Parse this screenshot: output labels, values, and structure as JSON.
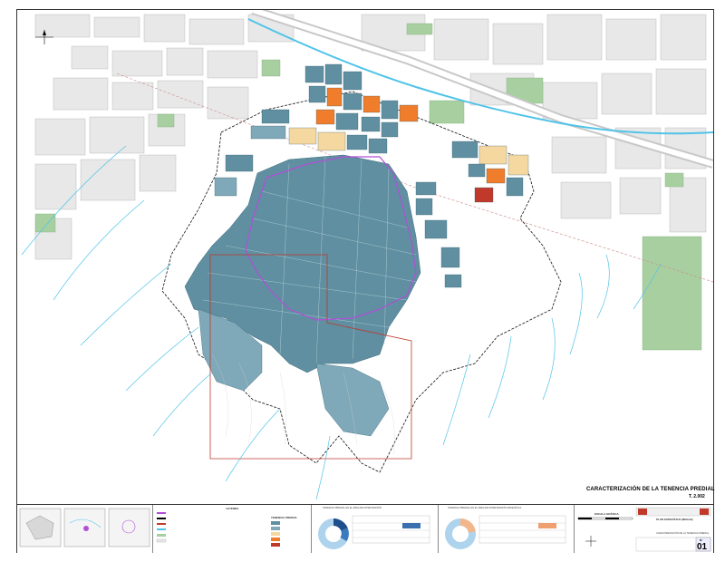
{
  "map": {
    "title": "CARACTERIZACIÓN DE LA TENENCIA PREDIAL",
    "subtitle": "T. 2.002"
  },
  "scale": {
    "label": "ESCALA GRÁFICA"
  },
  "titleblock": {
    "plan_name": "PLAN ESPECÍFICO (REGLB)",
    "plan_subject": "CARACTERIZACIÓN DE LA TENENCIA PREDIAL",
    "sheet_label": "N°",
    "sheet_number": "01"
  },
  "legend": {
    "header_left": "LEYENDA",
    "header_right": "TENENCIA PREDIAL"
  },
  "charts": {
    "chart1_title": "TENENCIA PREDIAL EN EL ÁREA DE INTERVENCIÓN",
    "chart2_title": "TENENCIA PREDIAL EN EL ÁREA DE INTERVENCIÓN ESPECÍFICA"
  },
  "colors": {
    "parcel_blue": "#5f8fa0",
    "parcel_light_blue": "#7fa8b8",
    "private_orange": "#ef7d2b",
    "community_tan": "#f5d7a0",
    "green_area": "#a8cfa0",
    "river_cyan": "#4fc3e8",
    "boundary_purple": "#b24fd8",
    "boundary_red": "#c0392b"
  }
}
